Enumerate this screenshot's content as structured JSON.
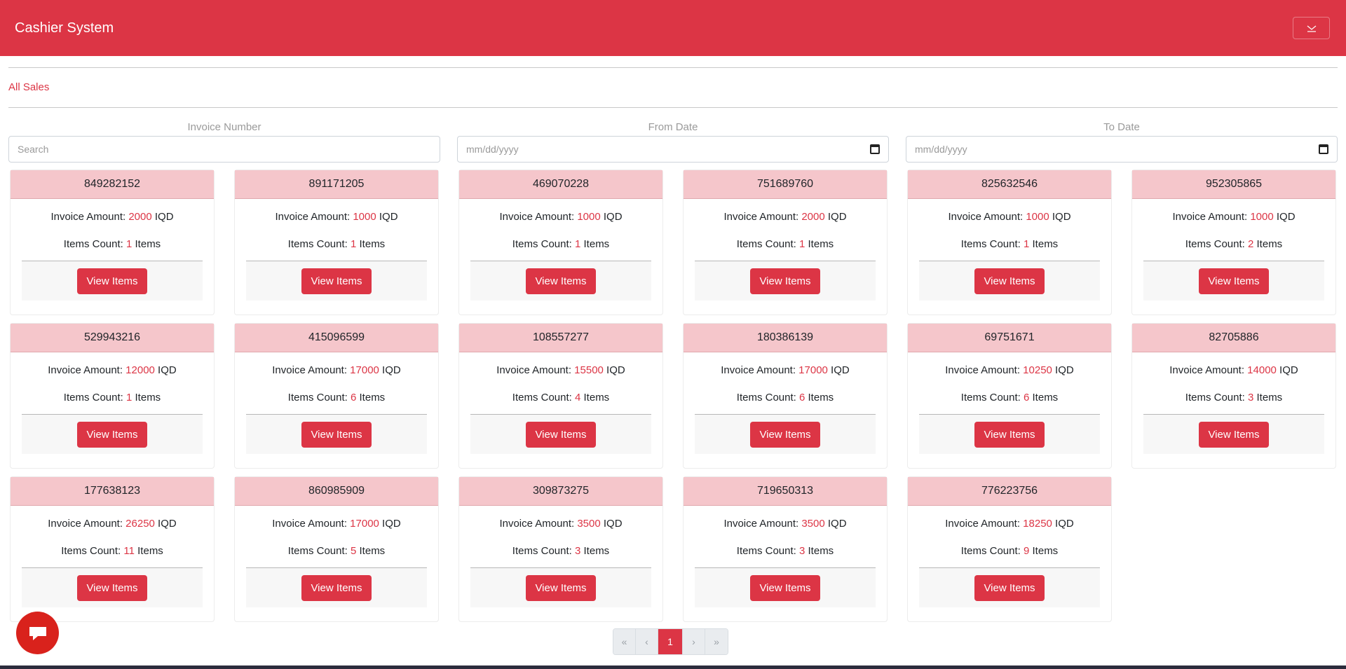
{
  "navbar": {
    "brand": "Cashier System",
    "toggle_icon": "chevron-down-icon"
  },
  "nav": {
    "all_sales": "All Sales"
  },
  "filters": [
    {
      "label": "Invoice Number",
      "placeholder": "Search",
      "icon": ""
    },
    {
      "label": "From Date",
      "placeholder": "mm/dd/yyyy",
      "icon": "calendar-icon"
    },
    {
      "label": "To Date",
      "placeholder": "mm/dd/yyyy",
      "icon": "calendar-icon"
    }
  ],
  "card_labels": {
    "amount_prefix": "Invoice Amount: ",
    "currency": " IQD",
    "count_prefix": "Items Count: ",
    "count_suffix": " Items",
    "button": "View Items"
  },
  "invoices": [
    {
      "number": "849282152",
      "amount": "2000",
      "count": "1"
    },
    {
      "number": "891171205",
      "amount": "1000",
      "count": "1"
    },
    {
      "number": "469070228",
      "amount": "1000",
      "count": "1"
    },
    {
      "number": "751689760",
      "amount": "2000",
      "count": "1"
    },
    {
      "number": "825632546",
      "amount": "1000",
      "count": "1"
    },
    {
      "number": "952305865",
      "amount": "1000",
      "count": "2"
    },
    {
      "number": "529943216",
      "amount": "12000",
      "count": "1"
    },
    {
      "number": "415096599",
      "amount": "17000",
      "count": "6"
    },
    {
      "number": "108557277",
      "amount": "15500",
      "count": "4"
    },
    {
      "number": "180386139",
      "amount": "17000",
      "count": "6"
    },
    {
      "number": "69751671",
      "amount": "10250",
      "count": "6"
    },
    {
      "number": "82705886",
      "amount": "14000",
      "count": "3"
    },
    {
      "number": "177638123",
      "amount": "26250",
      "count": "11"
    },
    {
      "number": "860985909",
      "amount": "17000",
      "count": "5"
    },
    {
      "number": "309873275",
      "amount": "3500",
      "count": "3"
    },
    {
      "number": "719650313",
      "amount": "3500",
      "count": "3"
    },
    {
      "number": "776223756",
      "amount": "18250",
      "count": "9"
    }
  ],
  "pagination": {
    "first": "«",
    "prev": "‹",
    "current": "1",
    "next": "›",
    "last": "»"
  },
  "chat": {
    "icon": "chat-icon"
  },
  "colors": {
    "primary": "#dc3545",
    "card_header": "#f5c6cb"
  }
}
